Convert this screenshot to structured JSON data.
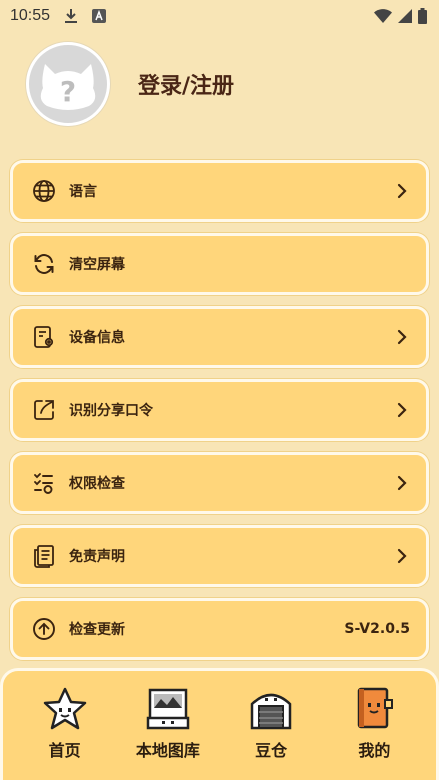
{
  "status_bar": {
    "time": "10:55",
    "icons": [
      "download-icon",
      "a-box-icon",
      "wifi-icon",
      "signal-icon",
      "battery-icon"
    ]
  },
  "profile": {
    "login_label": "登录/注册",
    "avatar_icon": "question-mark-icon"
  },
  "menu": [
    {
      "label": "语言",
      "icon": "globe-icon",
      "trailing": "chevron"
    },
    {
      "label": "清空屏幕",
      "icon": "refresh-icon",
      "trailing": ""
    },
    {
      "label": "设备信息",
      "icon": "device-settings-icon",
      "trailing": "chevron"
    },
    {
      "label": "识别分享口令",
      "icon": "share-code-icon",
      "trailing": "chevron"
    },
    {
      "label": "权限检查",
      "icon": "permission-check-icon",
      "trailing": "chevron"
    },
    {
      "label": "免责声明",
      "icon": "document-icon",
      "trailing": "chevron"
    },
    {
      "label": "检查更新",
      "icon": "upload-icon",
      "trailing_text": "S-V2.0.5"
    }
  ],
  "tabs": [
    {
      "label": "首页",
      "icon": "star-face-icon"
    },
    {
      "label": "本地图库",
      "icon": "gallery-icon"
    },
    {
      "label": "豆仓",
      "icon": "warehouse-icon"
    },
    {
      "label": "我的",
      "icon": "book-face-icon"
    }
  ],
  "colors": {
    "background": "#f8e5b6",
    "card": "#ffd67b",
    "card_border": "#fff9ea",
    "text": "#3b2410"
  }
}
